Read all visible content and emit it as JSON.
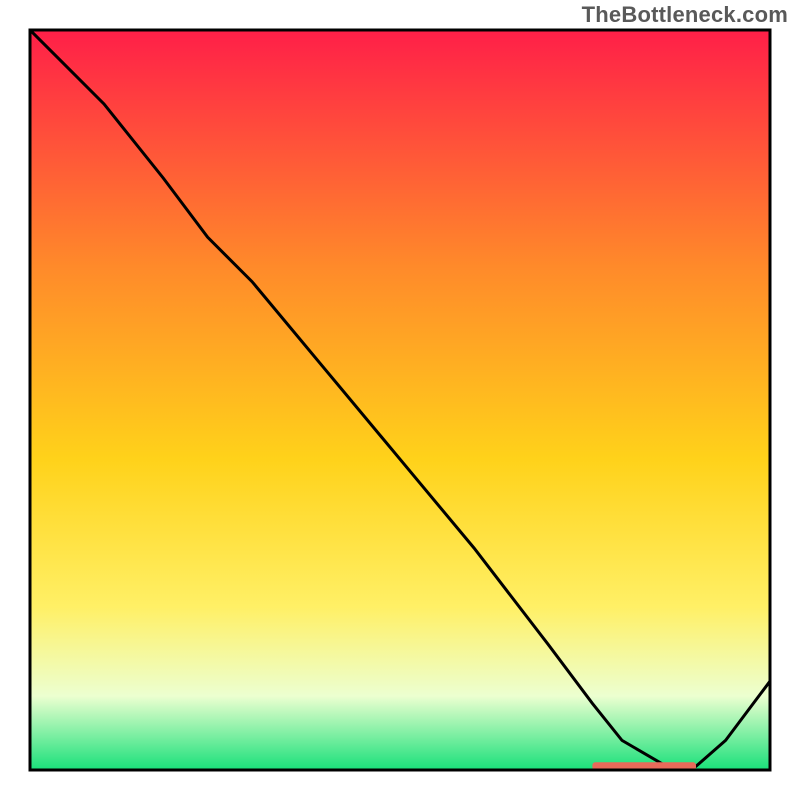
{
  "watermark": "TheBottleneck.com",
  "chart_data": {
    "type": "line",
    "title": "",
    "xlabel": "",
    "ylabel": "",
    "xlim": [
      0,
      100
    ],
    "ylim": [
      0,
      100
    ],
    "series": [
      {
        "name": "curve",
        "x": [
          0,
          4,
          10,
          18,
          24,
          30,
          40,
          50,
          60,
          70,
          76,
          80,
          86,
          90,
          94,
          100
        ],
        "y": [
          100,
          96,
          90,
          80,
          72,
          66,
          54,
          42,
          30,
          17,
          9,
          4,
          0.5,
          0.5,
          4,
          12
        ]
      }
    ],
    "band": {
      "x_start": 76,
      "x_end": 90,
      "y": 0.5,
      "color": "#e86a5a"
    },
    "colors": {
      "line": "#000000",
      "grad_top": "#ff1f48",
      "grad_mid1": "#ff8a2a",
      "grad_mid2": "#ffd21a",
      "grad_mid3": "#fff066",
      "grad_mid4": "#ecffd0",
      "grad_bottom": "#19e07a",
      "frame": "#000000"
    }
  }
}
